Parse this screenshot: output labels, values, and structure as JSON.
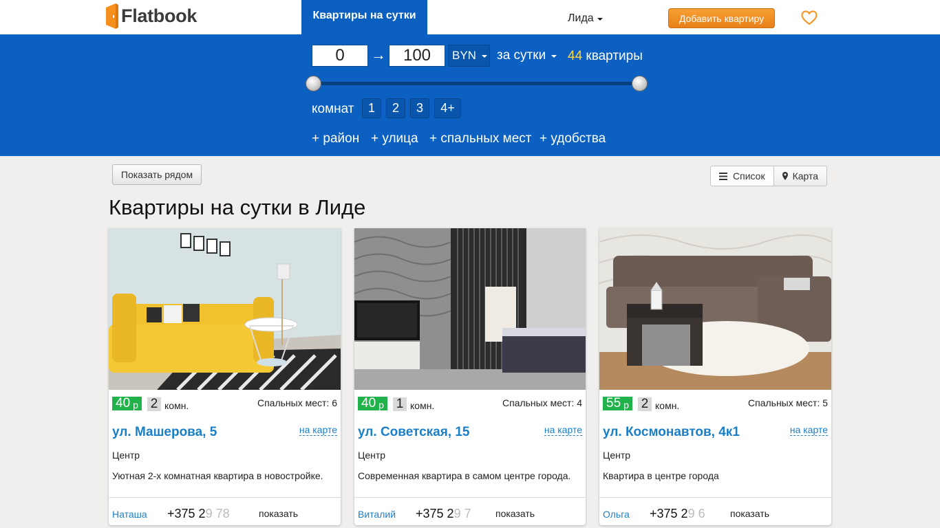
{
  "header": {
    "logo_text": "Flatbook",
    "nav_active": "Квартиры на сутки",
    "city": "Лида",
    "add_button": "Добавить квартиру",
    "favorites_icon": "heart-icon"
  },
  "filter": {
    "price_from": "0",
    "arrow": "→",
    "price_to": "100",
    "currency": "BYN",
    "period": "за сутки",
    "count": "44",
    "count_label": "квартиры",
    "rooms_label": "комнат",
    "rooms": [
      "1",
      "2",
      "3",
      "4+"
    ],
    "extras": [
      "+ район",
      "+ улица",
      "+ спальных мест",
      "+ удобства"
    ]
  },
  "toolbar": {
    "near_button": "Показать рядом",
    "list_button": "Список",
    "map_button": "Карта"
  },
  "page_title": "Квартиры на сутки в Лиде",
  "listings": [
    {
      "price": "40",
      "price_unit": "р",
      "rooms": "2",
      "rooms_label": "комн.",
      "beds": "Спальных мест: 6",
      "address": "ул. Машерова, 5",
      "map_link": "на карте",
      "district": "Центр",
      "description": "Уютная 2-х комнатная квартира в новостройке.",
      "owner": "Наташа",
      "phone_visible": "+375 2",
      "phone_faded": "9 78",
      "show_label": "показать"
    },
    {
      "price": "40",
      "price_unit": "р",
      "rooms": "1",
      "rooms_label": "комн.",
      "beds": "Спальных мест: 4",
      "address": "ул. Советская, 15",
      "map_link": "на карте",
      "district": "Центр",
      "description": "Современная квартира в самом центре города.",
      "owner": "Виталий",
      "phone_visible": "+375 2",
      "phone_faded": "9 7",
      "show_label": "показать"
    },
    {
      "price": "55",
      "price_unit": "р",
      "rooms": "2",
      "rooms_label": "комн.",
      "beds": "Спальных мест: 5",
      "address": "ул. Космонавтов, 4к1",
      "map_link": "на карте",
      "district": "Центр",
      "description": "Квартира в центре города",
      "owner": "Ольга",
      "phone_visible": "+375 2",
      "phone_faded": "9 6",
      "show_label": "показать"
    }
  ]
}
